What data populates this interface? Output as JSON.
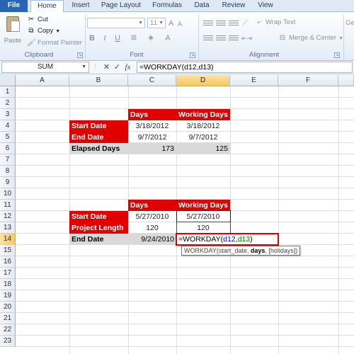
{
  "ribbon": {
    "tabs": [
      "File",
      "Home",
      "Insert",
      "Page Layout",
      "Formulas",
      "Data",
      "Review",
      "View"
    ],
    "clipboard": {
      "paste": "Paste",
      "cut": "Cut",
      "copy": "Copy",
      "format_painter": "Format Painter",
      "group": "Clipboard"
    },
    "font": {
      "size": "11",
      "group": "Font",
      "bold": "B",
      "italic": "I",
      "underline": "U"
    },
    "alignment": {
      "wrap_text": "Wrap Text",
      "merge_center": "Merge & Center",
      "group": "Alignment"
    },
    "number": {
      "partial": "Ge"
    }
  },
  "formula_bar": {
    "name_box": "SUM",
    "cancel": "✕",
    "enter": "✓",
    "fx": "fx",
    "formula": "=WORKDAY(d12,d13)"
  },
  "sheet": {
    "columns": [
      "A",
      "B",
      "C",
      "D",
      "E",
      "F"
    ],
    "rows": [
      "1",
      "2",
      "3",
      "4",
      "5",
      "6",
      "7",
      "8",
      "9",
      "10",
      "11",
      "12",
      "13",
      "14",
      "15",
      "16",
      "17",
      "18",
      "19",
      "20",
      "21",
      "22",
      "23"
    ],
    "table1": {
      "header_days": "Days",
      "header_working": "Working Days",
      "start_label": "Start Date",
      "start_days": "3/18/2012",
      "start_working": "3/18/2012",
      "end_label": "End Date",
      "end_days": "9/7/2012",
      "end_working": "9/7/2012",
      "elapsed_label": "Elapsed Days",
      "elapsed_days": "173",
      "elapsed_working": "125"
    },
    "table2": {
      "header_days": "Days",
      "header_working": "Working Days",
      "start_label": "Start Date",
      "start_days": "5/27/2010",
      "start_working": "5/27/2010",
      "length_label": "Project Length",
      "length_days": "120",
      "length_working": "120",
      "end_label": "End Date",
      "end_days": "9/24/2010",
      "edit_prefix": "=WORKDAY(",
      "edit_ref1": "d12",
      "edit_comma": ",",
      "edit_ref2": "d13",
      "edit_suffix": ")"
    },
    "tooltip": {
      "fn": "WORKDAY(start_date, ",
      "bold_arg": "days",
      "rest": ", [holidays])"
    }
  }
}
